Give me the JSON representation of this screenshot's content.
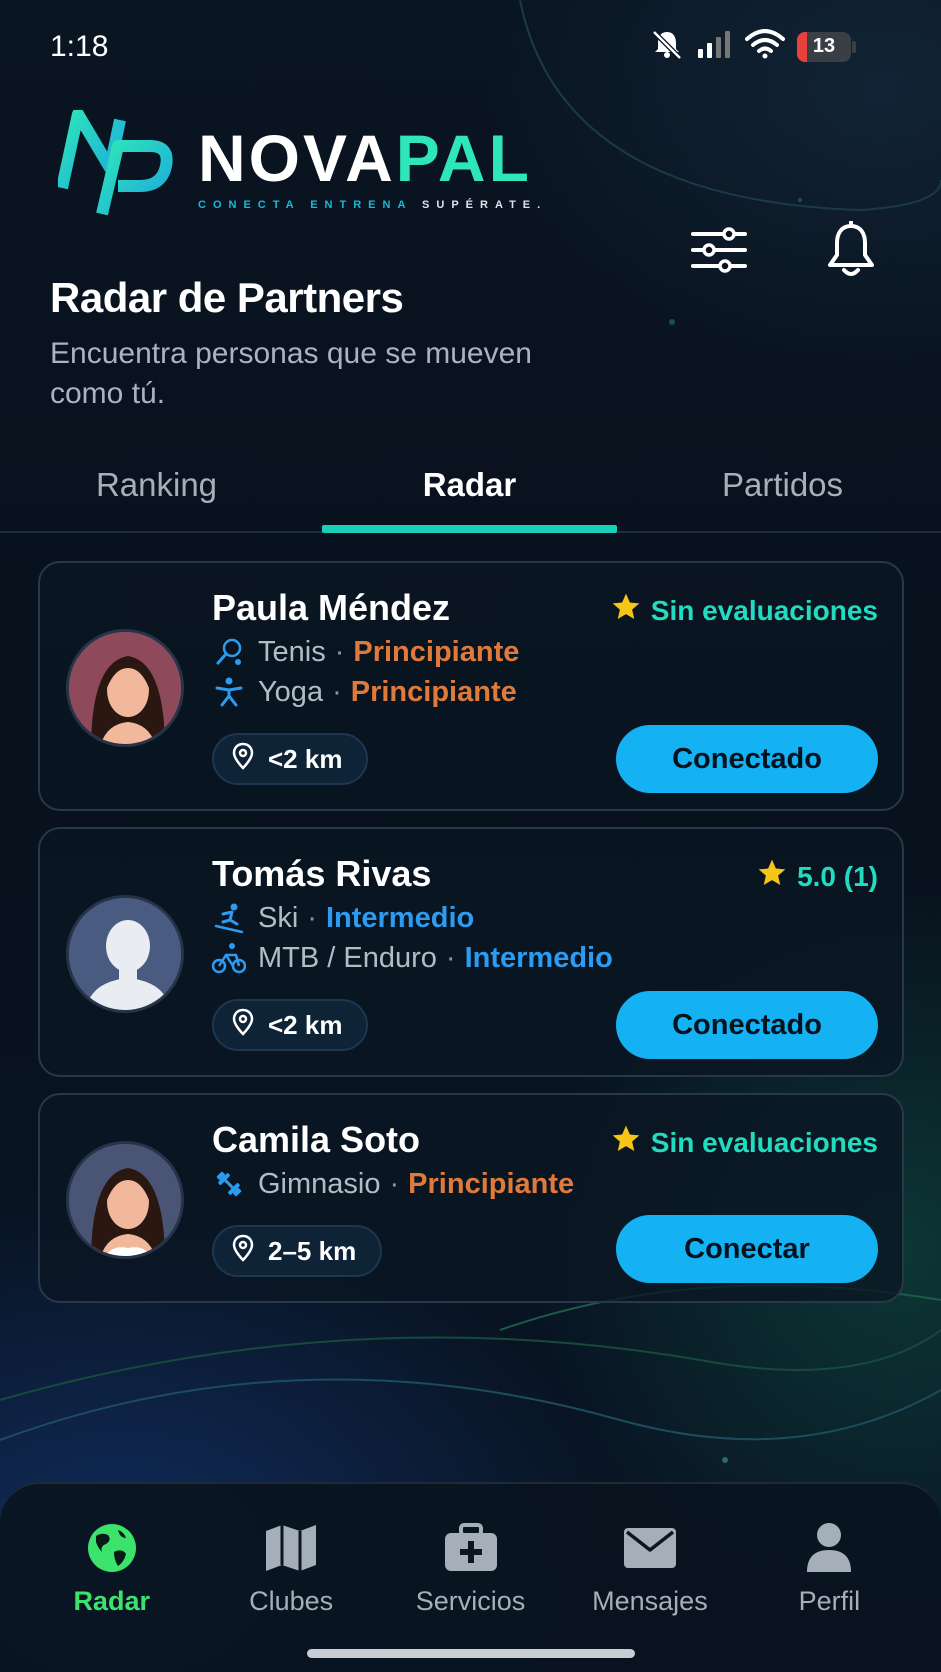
{
  "status_bar": {
    "time": "1:18",
    "battery": "13"
  },
  "brand": {
    "name_white": "NOVA",
    "name_green": "PAL",
    "tagline_a": "CONECTA ENTRENA",
    "tagline_b": "SUPÉRATE."
  },
  "header": {
    "title": "Radar de Partners",
    "subtitle": "Encuentra personas que se mueven como tú."
  },
  "tabs": [
    {
      "label": "Ranking",
      "active": false
    },
    {
      "label": "Radar",
      "active": true
    },
    {
      "label": "Partidos",
      "active": false
    }
  ],
  "cards": [
    {
      "name": "Paula Méndez",
      "rating": "Sin evaluaciones",
      "sports": [
        {
          "icon": "tennis-icon",
          "sport": "Tenis",
          "level": "Principiante"
        },
        {
          "icon": "yoga-icon",
          "sport": "Yoga",
          "level": "Principiante"
        }
      ],
      "distance": "<2 km",
      "action": "Conectado"
    },
    {
      "name": "Tomás Rivas",
      "rating": "5.0 (1)",
      "sports": [
        {
          "icon": "ski-icon",
          "sport": "Ski",
          "level": "Intermedio"
        },
        {
          "icon": "bike-icon",
          "sport": "MTB / Enduro",
          "level": "Intermedio"
        }
      ],
      "distance": "<2 km",
      "action": "Conectado"
    },
    {
      "name": "Camila Soto",
      "rating": "Sin evaluaciones",
      "sports": [
        {
          "icon": "dumbbell-icon",
          "sport": "Gimnasio",
          "level": "Principiante"
        }
      ],
      "distance": "2–5 km",
      "action": "Conectar"
    }
  ],
  "nav": [
    {
      "label": "Radar",
      "icon": "globe-icon",
      "active": true
    },
    {
      "label": "Clubes",
      "icon": "map-icon",
      "active": false
    },
    {
      "label": "Servicios",
      "icon": "first-aid-icon",
      "active": false
    },
    {
      "label": "Mensajes",
      "icon": "envelope-icon",
      "active": false
    },
    {
      "label": "Perfil",
      "icon": "user-icon",
      "active": false
    }
  ],
  "colors": {
    "accent_teal": "#18d0b7",
    "button_blue": "#14b2f3",
    "level_beginner": "#e07a3a",
    "level_intermediate": "#2d9bf0",
    "nav_active": "#3be26b",
    "star": "#f5c518"
  }
}
